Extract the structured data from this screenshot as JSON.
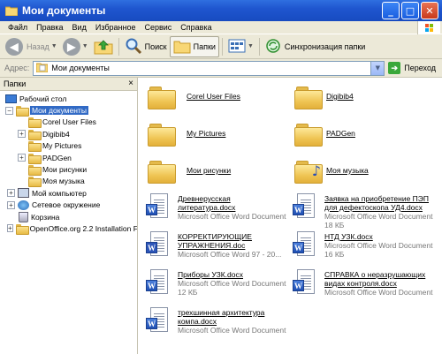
{
  "window": {
    "title": "Мои документы",
    "buttons": {
      "minimize": "_",
      "maximize": "□",
      "close": "✕"
    }
  },
  "menu": [
    "Файл",
    "Правка",
    "Вид",
    "Избранное",
    "Сервис",
    "Справка"
  ],
  "toolbar": {
    "back": "Назад",
    "search": "Поиск",
    "folders": "Папки",
    "sync": "Синхронизация папки"
  },
  "address": {
    "label": "Адрес:",
    "value": "Мои документы",
    "go": "Переход"
  },
  "folders_pane": {
    "title": "Папки",
    "close": "×",
    "tree": [
      {
        "label": "Рабочий стол",
        "indent": 0,
        "expander": "",
        "icon": "desktop-icon"
      },
      {
        "label": "Мои документы",
        "indent": 1,
        "expander": "−",
        "icon": "my-documents-icon",
        "selected": true
      },
      {
        "label": "Corel User Files",
        "indent": 2,
        "expander": "",
        "icon": "folder-icon"
      },
      {
        "label": "Digibib4",
        "indent": 2,
        "expander": "+",
        "icon": "folder-icon"
      },
      {
        "label": "My Pictures",
        "indent": 2,
        "expander": "",
        "icon": "folder-icon"
      },
      {
        "label": "PADGen",
        "indent": 2,
        "expander": "+",
        "icon": "folder-icon"
      },
      {
        "label": "Мои рисунки",
        "indent": 2,
        "expander": "",
        "icon": "folder-icon"
      },
      {
        "label": "Моя музыка",
        "indent": 2,
        "expander": "",
        "icon": "music-folder-icon"
      },
      {
        "label": "Мой компьютер",
        "indent": 1,
        "expander": "+",
        "icon": "computer-icon"
      },
      {
        "label": "Сетевое окружение",
        "indent": 1,
        "expander": "+",
        "icon": "network-icon"
      },
      {
        "label": "Корзина",
        "indent": 1,
        "expander": "",
        "icon": "recycle-bin-icon"
      },
      {
        "label": "OpenOffice.org 2.2 Installation F",
        "indent": 1,
        "expander": "+",
        "icon": "folder-icon"
      }
    ]
  },
  "content": {
    "folders": [
      {
        "name": "Corel User Files"
      },
      {
        "name": "Digibib4"
      },
      {
        "name": "My Pictures"
      },
      {
        "name": "PADGen"
      },
      {
        "name": "Мои рисунки"
      },
      {
        "name": "Моя музыка",
        "music": true
      }
    ],
    "files": [
      {
        "line1": "Древнерусская",
        "line2": "литература.docx",
        "type": "Microsoft Office Word Document",
        "size": ""
      },
      {
        "line1": "Заявка на приобретение ПЭП",
        "line2": "для дефектоскопа УД4.docx",
        "type": "Microsoft Office Word Document",
        "size": "18 КБ"
      },
      {
        "line1": "КОРРЕКТИРУЮЩИЕ",
        "line2": "УПРАЖНЕНИЯ.doc",
        "type": "Microsoft Office Word 97 - 20...",
        "size": ""
      },
      {
        "line1": "НТД УЗК.docx",
        "line2": "",
        "type": "Microsoft Office Word Document",
        "size": "16 КБ"
      },
      {
        "line1": "Приборы УЗК.docx",
        "line2": "",
        "type": "Microsoft Office Word Document",
        "size": "12 КБ"
      },
      {
        "line1": "СПРАВКА о неразрушающих",
        "line2": "видах контроля.docx",
        "type": "Microsoft Office Word Document",
        "size": ""
      },
      {
        "line1": "трехшинная архитектура",
        "line2": "компа.docx",
        "type": "Microsoft Office Word Document",
        "size": ""
      }
    ]
  }
}
